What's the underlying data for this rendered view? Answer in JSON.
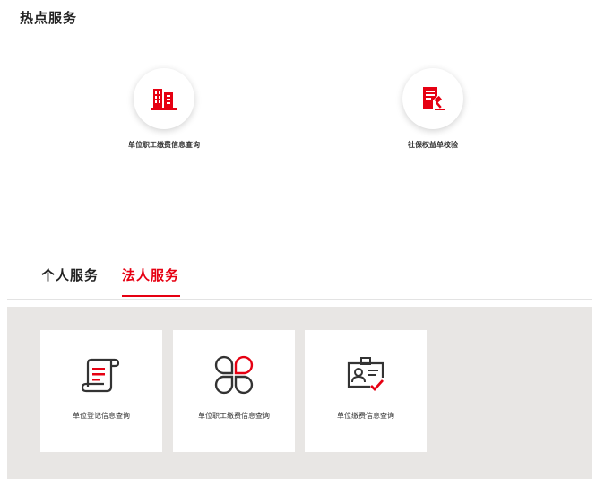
{
  "hot_services": {
    "title": "热点服务",
    "items": [
      {
        "label": "单位职工缴费信息查询",
        "icon": "building-icon"
      },
      {
        "label": "社保权益单校验",
        "icon": "document-gavel-icon"
      }
    ]
  },
  "tabs": [
    {
      "label": "个人服务",
      "active": false
    },
    {
      "label": "法人服务",
      "active": true
    }
  ],
  "service_cards": [
    {
      "label": "单位登记信息查询",
      "icon": "scroll-document-icon"
    },
    {
      "label": "单位职工缴费信息查询",
      "icon": "four-petal-icon"
    },
    {
      "label": "单位缴费信息查询",
      "icon": "id-card-check-icon"
    }
  ],
  "colors": {
    "accent": "#e60012",
    "panel_bg": "#e8e6e4",
    "icon_dark": "#333333"
  }
}
